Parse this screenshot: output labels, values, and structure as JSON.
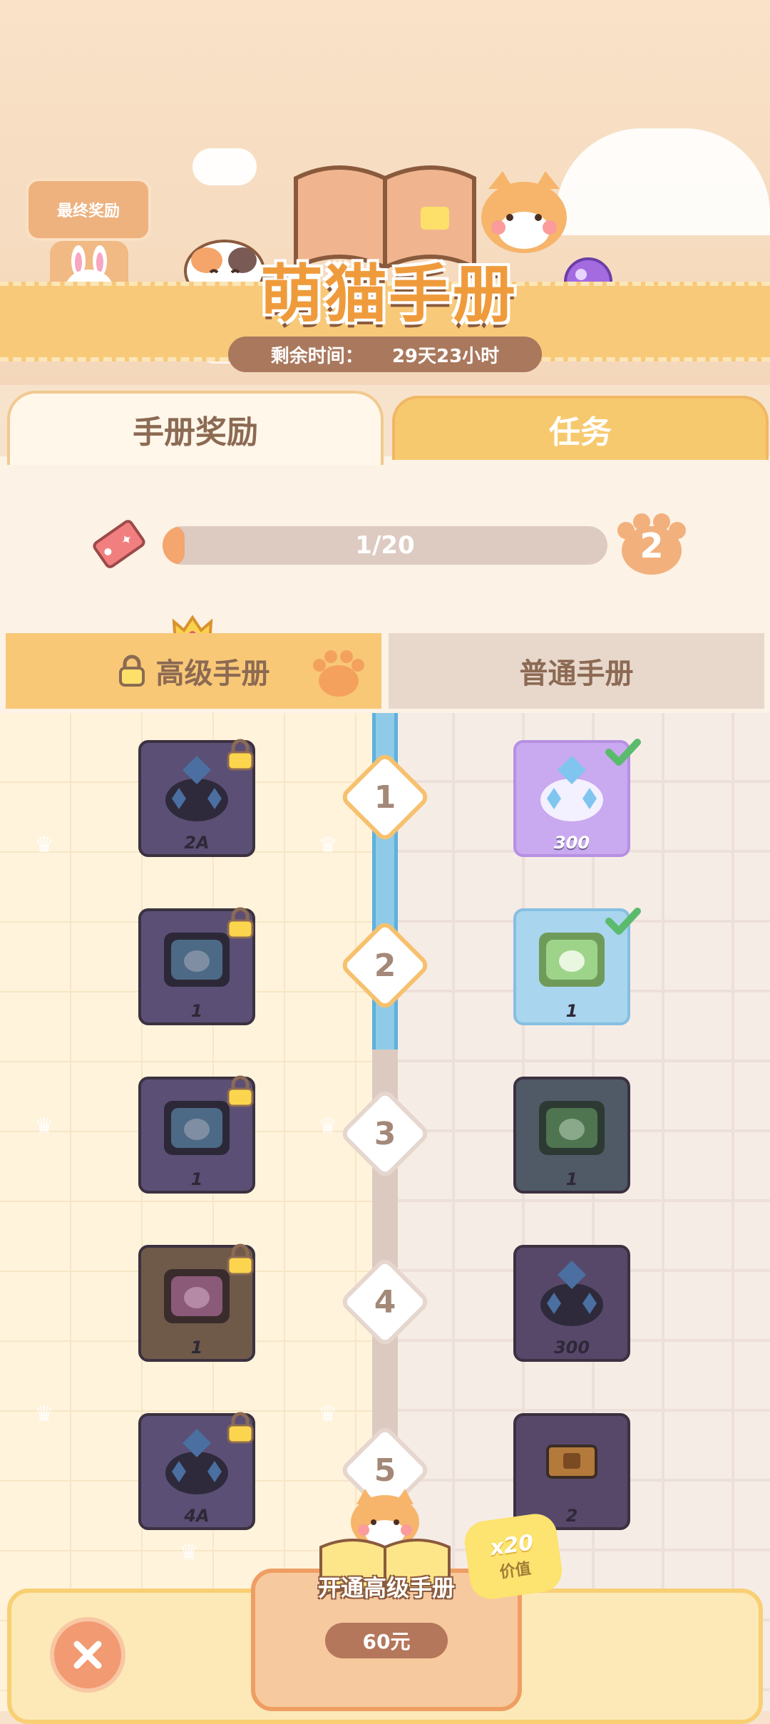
{
  "header": {
    "title": "萌猫手册",
    "final_reward_label": "最终奖励",
    "remain_label": "剩余时间：",
    "remain_value": "29天23小时"
  },
  "tabs": [
    {
      "label": "手册奖励",
      "active": true
    },
    {
      "label": "任务",
      "active": false
    }
  ],
  "progress": {
    "text": "1/20",
    "value": 1,
    "max": 20,
    "level": "2"
  },
  "columns": {
    "premium": "高级手册",
    "normal": "普通手册"
  },
  "levels": [
    {
      "num": "1",
      "done": true,
      "premium": {
        "icon": "crystal-bag-icon",
        "qty": "2A",
        "locked": true
      },
      "normal": {
        "icon": "crystal-bag-icon",
        "qty": "300",
        "claimed": true,
        "color": "purple"
      }
    },
    {
      "num": "2",
      "done": true,
      "premium": {
        "icon": "blue-cat-chest-icon",
        "qty": "1",
        "locked": true
      },
      "normal": {
        "icon": "green-cat-chest-icon",
        "qty": "1",
        "claimed": true,
        "color": "blue"
      }
    },
    {
      "num": "3",
      "done": false,
      "premium": {
        "icon": "blue-cat-chest-icon",
        "qty": "1",
        "locked": true
      },
      "normal": {
        "icon": "green-cat-chest-icon",
        "qty": "1",
        "claimed": false,
        "color": "slate"
      }
    },
    {
      "num": "4",
      "done": false,
      "premium": {
        "icon": "purple-cat-chest-icon",
        "qty": "1",
        "locked": true
      },
      "normal": {
        "icon": "crystal-bag-icon",
        "qty": "300",
        "claimed": false,
        "color": "dark"
      }
    },
    {
      "num": "5",
      "done": false,
      "premium": {
        "icon": "crystal-bag-icon",
        "qty": "4A",
        "locked": true
      },
      "normal": {
        "icon": "ticket-icon",
        "qty": "2",
        "claimed": false,
        "color": "dark"
      }
    }
  ],
  "bottom": {
    "unlock_label": "开通高级手册",
    "price": "60元",
    "value_multiplier": "x20",
    "value_label": "价值"
  },
  "colors": {
    "accent_orange": "#f5a56e",
    "rail_blue": "#8fcbe8",
    "banner_yellow": "#f7c979"
  }
}
